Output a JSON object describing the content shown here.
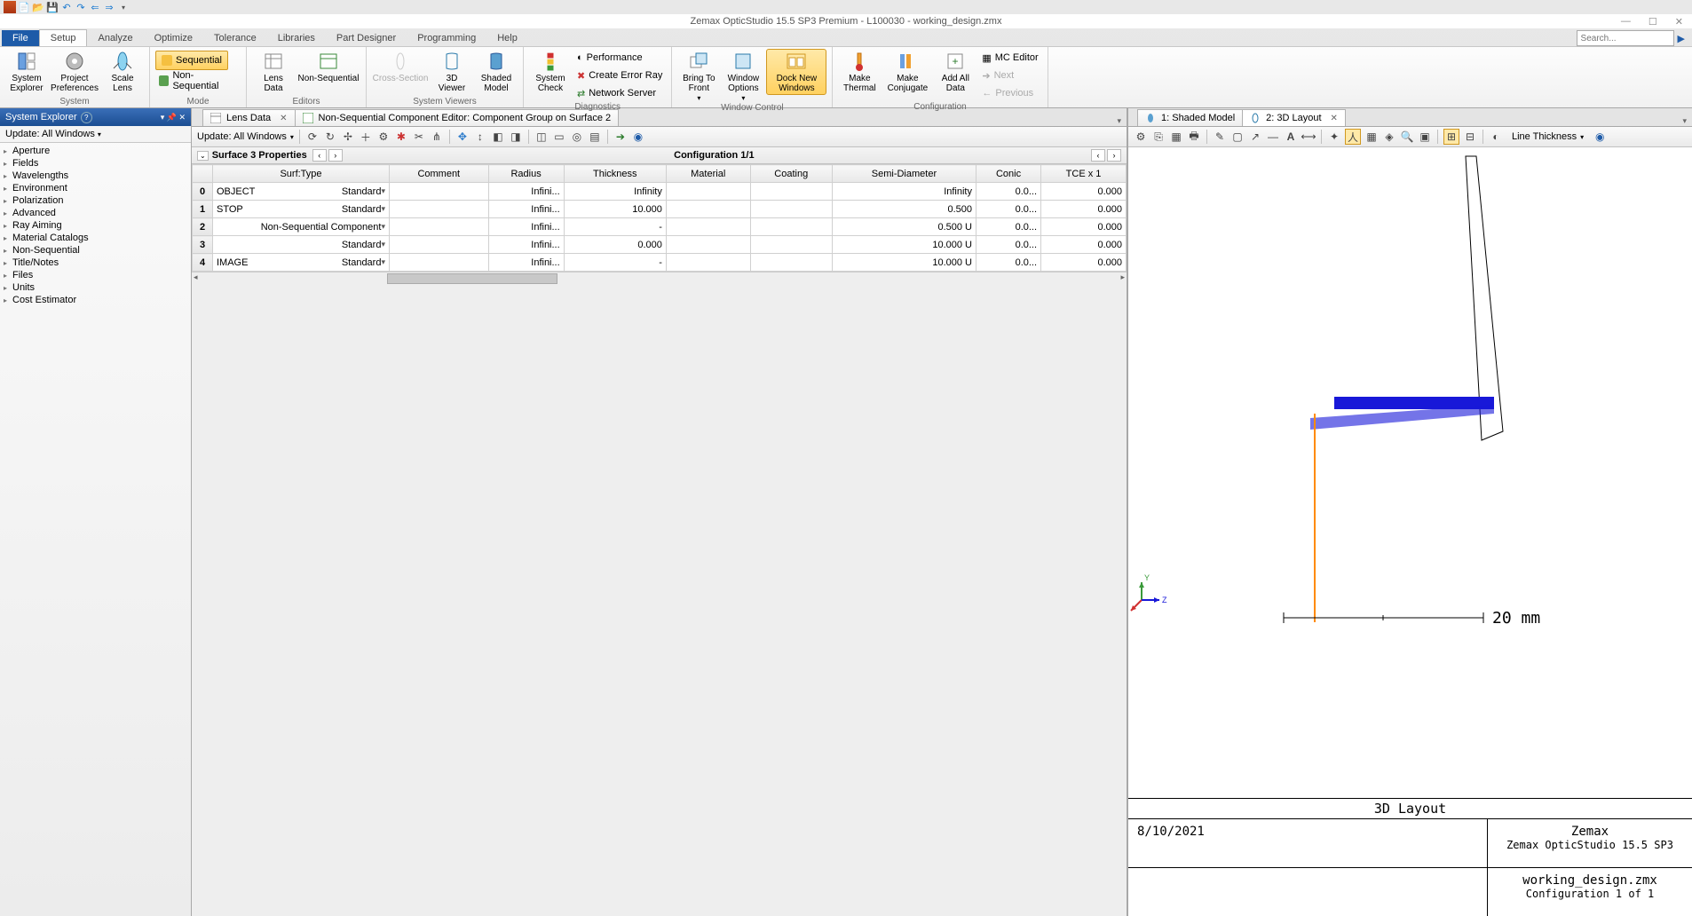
{
  "title": "Zemax OpticStudio 15.5 SP3   Premium - L100030 - working_design.zmx",
  "search_placeholder": "Search...",
  "menu": {
    "file": "File",
    "setup": "Setup",
    "analyze": "Analyze",
    "optimize": "Optimize",
    "tolerance": "Tolerance",
    "libraries": "Libraries",
    "partdesigner": "Part Designer",
    "programming": "Programming",
    "help": "Help"
  },
  "ribbon": {
    "system": {
      "explorer": "System\nExplorer",
      "prefs": "Project\nPreferences",
      "scale": "Scale\nLens",
      "label": "System"
    },
    "mode": {
      "seq": "Sequential",
      "nonseq": "Non-Sequential",
      "label": "Mode"
    },
    "editors": {
      "lensdata": "Lens\nData",
      "nonseq": "Non-Sequential",
      "label": "Editors"
    },
    "viewers": {
      "cross": "Cross-Section",
      "v3d": "3D\nViewer",
      "shaded": "Shaded\nModel",
      "label": "System Viewers"
    },
    "diag": {
      "check": "System\nCheck",
      "perf": "Performance",
      "err": "Create Error Ray",
      "net": "Network Server",
      "label": "Diagnostics"
    },
    "winctrl": {
      "bring": "Bring To\nFront",
      "opts": "Window\nOptions",
      "dock": "Dock New\nWindows",
      "label": "Window Control"
    },
    "config": {
      "thermal": "Make\nThermal",
      "conj": "Make\nConjugate",
      "addall": "Add All\nData",
      "mc": "MC Editor",
      "next": "Next",
      "prev": "Previous",
      "label": "Configuration"
    }
  },
  "sysexplorer": {
    "title": "System Explorer",
    "help": "?",
    "update": "Update: All Windows",
    "items": [
      "Aperture",
      "Fields",
      "Wavelengths",
      "Environment",
      "Polarization",
      "Advanced",
      "Ray Aiming",
      "Material Catalogs",
      "Non-Sequential",
      "Title/Notes",
      "Files",
      "Units",
      "Cost Estimator"
    ]
  },
  "doctabs": {
    "lens": "Lens Data",
    "nsc": "Non-Sequential Component Editor: Component Group on Surface 2"
  },
  "lde": {
    "update": "Update: All Windows",
    "prop": "Surface 3 Properties",
    "config": "Configuration 1/1",
    "cols": [
      "Surf:Type",
      "Comment",
      "Radius",
      "Thickness",
      "Material",
      "Coating",
      "Semi-Diameter",
      "Conic",
      "TCE x 1"
    ],
    "rows": [
      {
        "n": "0",
        "name": "OBJECT",
        "type": "Standard",
        "rad": "Infini...",
        "thk": "Infinity",
        "sd": "Infinity",
        "sdu": "",
        "con": "0.0...",
        "tce": "0.000"
      },
      {
        "n": "1",
        "name": "STOP",
        "type": "Standard",
        "rad": "Infini...",
        "thk": "10.000",
        "sd": "0.500",
        "sdu": "",
        "con": "0.0...",
        "tce": "0.000"
      },
      {
        "n": "2",
        "name": "",
        "type": "Non-Sequential Component",
        "rad": "Infini...",
        "thk": "-",
        "sd": "0.500",
        "sdu": "U",
        "con": "0.0...",
        "tce": "0.000"
      },
      {
        "n": "3",
        "name": "",
        "type": "Standard",
        "rad": "Infini...",
        "thk": "0.000",
        "sd": "10.000",
        "sdu": "U",
        "con": "0.0...",
        "tce": "0.000"
      },
      {
        "n": "4",
        "name": "IMAGE",
        "type": "Standard",
        "rad": "Infini...",
        "thk": "-",
        "sd": "10.000",
        "sdu": "U",
        "con": "0.0...",
        "tce": "0.000"
      }
    ]
  },
  "righttabs": {
    "shaded": "1: Shaded Model",
    "layout": "2: 3D Layout"
  },
  "rtoolbar": {
    "linethk": "Line Thickness"
  },
  "layout": {
    "scale": "20 mm",
    "title": "3D Layout",
    "date": "8/10/2021",
    "brand1": "Zemax",
    "brand2": "Zemax OpticStudio 15.5 SP3",
    "file": "working_design.zmx",
    "cfg": "Configuration 1 of 1",
    "axes": {
      "y": "Y",
      "z": "Z"
    }
  }
}
